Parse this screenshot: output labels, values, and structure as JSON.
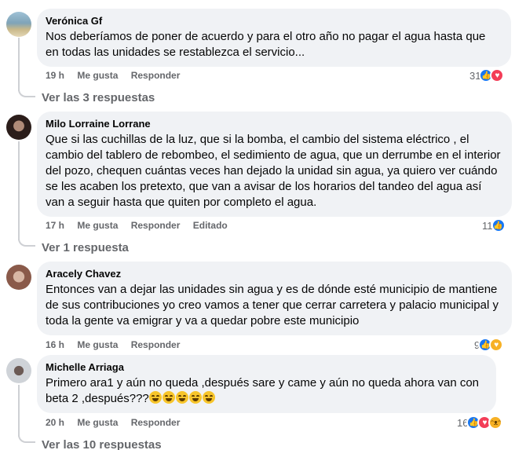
{
  "comments": [
    {
      "author": "Verónica Gf",
      "text": "Nos deberíamos de poner de acuerdo y para el otro año no pagar el agua hasta que en todas las unidades se restablezca el servicio...",
      "time": "19 h",
      "like": "Me gusta",
      "reply": "Responder",
      "reaction_count": "31",
      "reactions": [
        "like-icon",
        "love-icon"
      ],
      "replies_link": "Ver las 3 respuestas",
      "avatar_colors": [
        "#7fa3b8",
        "#c9b98a"
      ]
    },
    {
      "author": "Milo Lorraine Lorrane",
      "text": "Que si las cuchillas de la luz, que si la bomba, el cambio del sistema eléctrico , el cambio del tablero de rebombeo, el sedimiento de agua, que un derrumbe en el interior del pozo, chequen cuántas veces han dejado la unidad sin agua, ya quiero ver cuándo se les acaben los pretexto, que van a avisar de los horarios del tandeo del agua así van a seguir hasta que quiten por completo el agua.",
      "time": "17 h",
      "like": "Me gusta",
      "reply": "Responder",
      "edited": "Editado",
      "reaction_count": "11",
      "reactions": [
        "like-icon"
      ],
      "replies_link": "Ver 1 respuesta",
      "avatar_colors": [
        "#2b1d1a",
        "#b08b78"
      ]
    },
    {
      "author": "Aracely Chavez",
      "text": "Entonces van a dejar las unidades sin agua y es de dónde esté municipio de mantiene de sus contribuciones yo creo vamos a tener que cerrar carretera y palacio municipal y toda la gente va emigrar y va a quedar pobre este municipio",
      "time": "16 h",
      "like": "Me gusta",
      "reply": "Responder",
      "reaction_count": "9",
      "reactions": [
        "like-icon",
        "care-icon"
      ],
      "avatar_colors": [
        "#8a5a4a",
        "#d8b7a5"
      ]
    },
    {
      "author": "Michelle Arriaga",
      "text": "Primero ara1 y aún no queda ,después sare y came y aún no queda ahora van con beta 2 ,después???",
      "emoji_count": 5,
      "time": "20 h",
      "like": "Me gusta",
      "reply": "Responder",
      "reaction_count": "16",
      "reactions": [
        "like-icon",
        "love-icon",
        "haha-icon"
      ],
      "replies_link": "Ver las 10 respuestas",
      "avatar_colors": [
        "#cfd3d8",
        "#6b5a55"
      ]
    }
  ],
  "colors": {
    "bubble": "#f0f2f5",
    "meta": "#65676b",
    "like": "#1877f2",
    "love": "#f33e58",
    "haha": "#f7b125"
  }
}
